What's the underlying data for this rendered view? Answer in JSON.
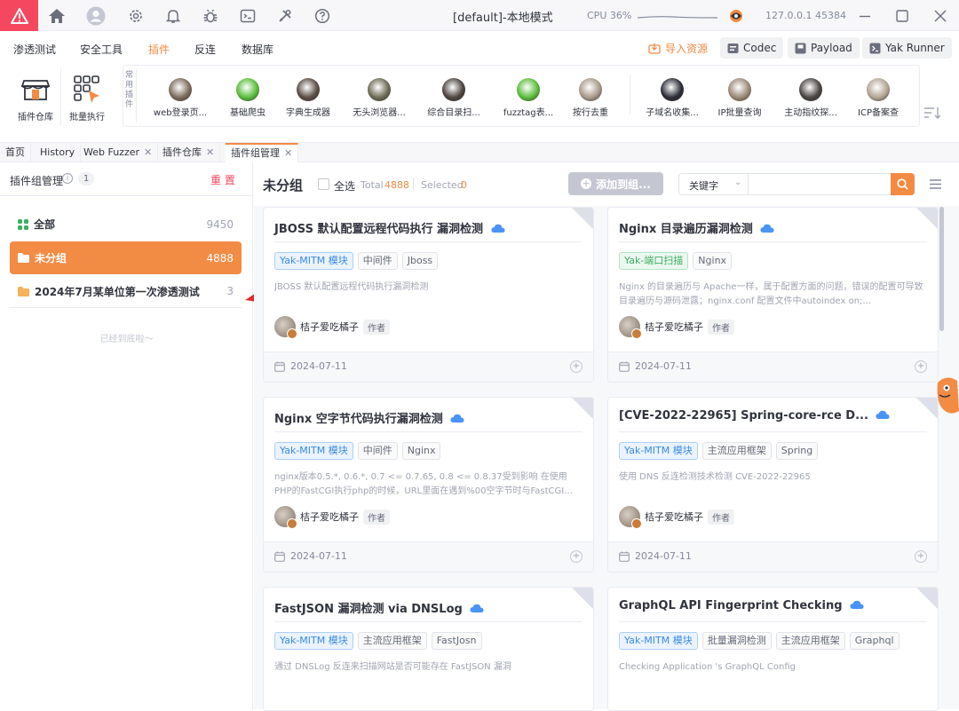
{
  "title": "[default]-本地模式",
  "cpu": "CPU 36%",
  "ip": "127.0.0.1 45384",
  "menus": [
    "渗透测试",
    "安全工具",
    "插件",
    "反连",
    "数据库"
  ],
  "right_buttons": {
    "import": "导入资源",
    "codec": "Codec",
    "payload": "Payload",
    "runner": "Yak Runner"
  },
  "tools": {
    "store": "插件仓库",
    "batch": "批量执行"
  },
  "common_label": "常用插件",
  "common_plugins": [
    {
      "label": "web登录页...",
      "color": "#7b6c5c"
    },
    {
      "label": "基础爬虫",
      "color": "#5bbd3c"
    },
    {
      "label": "字典生成器",
      "color": "#5a4d45"
    },
    {
      "label": "无头浏览器...",
      "color": "#6e6b55"
    },
    {
      "label": "综合目录扫...",
      "color": "#4d4540"
    },
    {
      "label": "fuzztag表...",
      "color": "#5bbd3c"
    },
    {
      "label": "按行去重",
      "color": "#a89a8b"
    },
    {
      "label": "子域名收集...",
      "color": "#2b2d38"
    },
    {
      "label": "IP批量查询",
      "color": "#9a8a78"
    },
    {
      "label": "主动指纹探...",
      "color": "#4a4543"
    },
    {
      "label": "ICP备案查",
      "color": "#b2a596"
    }
  ],
  "tabs": [
    {
      "label": "首页"
    },
    {
      "label": "History"
    },
    {
      "label": "Web Fuzzer"
    },
    {
      "label": "插件仓库"
    },
    {
      "label": "插件组管理"
    }
  ],
  "sidebar": {
    "title": "插件组管理",
    "count": "1",
    "reset": "重 置",
    "groups": [
      {
        "label": "全部",
        "count": "9450"
      },
      {
        "label": "未分组",
        "count": "4888"
      },
      {
        "label": "2024年7月某单位第一次渗透测试",
        "count": "3"
      }
    ],
    "bottom": "已经到底啦～"
  },
  "main": {
    "heading": "未分组",
    "select_all": "全选",
    "total_label": "Total",
    "total": "4888",
    "selected_label": "Selected",
    "selected": "0",
    "add_btn": "添加到组...",
    "search_type": "关键字",
    "search_placeholder": ""
  },
  "cards": [
    {
      "title": "JBOSS 默认配置远程代码执行 漏洞检测",
      "tags": [
        {
          "t": "Yak-MITM 模块",
          "c": "blue"
        },
        {
          "t": "中间件",
          "c": ""
        },
        {
          "t": "Jboss",
          "c": ""
        }
      ],
      "desc": "JBOSS 默认配置远程代码执行漏洞检测",
      "author": "桔子爱吃橘子",
      "author_tag": "作者",
      "date": "2024-07-11"
    },
    {
      "title": "Nginx 目录遍历漏洞检测",
      "tags": [
        {
          "t": "Yak-端口扫描",
          "c": "green"
        },
        {
          "t": "Nginx",
          "c": ""
        }
      ],
      "desc": "Nginx 的目录遍历与 Apache一样，属于配置方面的问题，错误的配置可导致目录遍历与源码泄露；nginx.conf 配置文件中autoindex on;...",
      "author": "桔子爱吃橘子",
      "author_tag": "作者",
      "date": "2024-07-11"
    },
    {
      "title": "Nginx 空字节代码执行漏洞检测",
      "tags": [
        {
          "t": "Yak-MITM 模块",
          "c": "blue"
        },
        {
          "t": "中间件",
          "c": ""
        },
        {
          "t": "Nginx",
          "c": ""
        }
      ],
      "desc": "nginx版本0.5.*, 0.6.*, 0.7 <= 0.7.65, 0.8 <= 0.8.37受到影响 在使用PHP的FastCGI执行php的时候，URL里面在遇到%00空字节时与FastCGI...",
      "author": "桔子爱吃橘子",
      "author_tag": "作者",
      "date": "2024-07-11"
    },
    {
      "title": "[CVE-2022-22965] Spring-core-rce D...",
      "tags": [
        {
          "t": "Yak-MITM 模块",
          "c": "blue"
        },
        {
          "t": "主流应用框架",
          "c": ""
        },
        {
          "t": "Spring",
          "c": ""
        }
      ],
      "desc": "使用 DNS 反连检测技术检测 CVE-2022-22965",
      "author": "桔子爱吃橘子",
      "author_tag": "作者",
      "date": "2024-07-11"
    },
    {
      "title": "FastJSON 漏洞检测 via DNSLog",
      "tags": [
        {
          "t": "Yak-MITM 模块",
          "c": "blue"
        },
        {
          "t": "主流应用框架",
          "c": ""
        },
        {
          "t": "FastJosn",
          "c": ""
        }
      ],
      "desc": "通过 DNSLog 反连来扫描网站是否可能存在 FastJSON 漏洞",
      "author": "",
      "author_tag": "",
      "date": ""
    },
    {
      "title": "GraphQL API Fingerprint Checking",
      "tags": [
        {
          "t": "Yak-MITM 模块",
          "c": "blue"
        },
        {
          "t": "批量漏洞检测",
          "c": ""
        },
        {
          "t": "主流应用框架",
          "c": ""
        },
        {
          "t": "Graphql",
          "c": ""
        }
      ],
      "desc": "Checking Application 's GraphQL Config",
      "author": "",
      "author_tag": "",
      "date": ""
    }
  ]
}
